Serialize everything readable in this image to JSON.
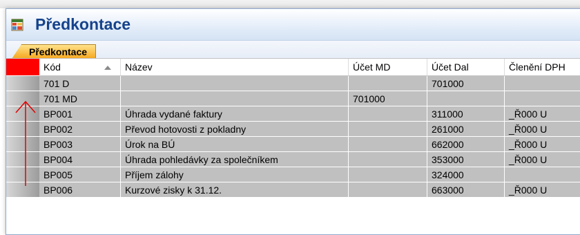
{
  "window": {
    "title": "Předkontace"
  },
  "tab": {
    "label": "Předkontace"
  },
  "grid": {
    "columns": [
      "Kód",
      "Název",
      "Účet MD",
      "Účet Dal",
      "Členění DPH"
    ],
    "sorted_column": "Kód",
    "sort_direction": "ascending",
    "rows": [
      {
        "kod": "701 D",
        "nazev": "",
        "ucet_md": "",
        "ucet_dal": "701000",
        "cleneni_dph": ""
      },
      {
        "kod": "701 MD",
        "nazev": "",
        "ucet_md": "701000",
        "ucet_dal": "",
        "cleneni_dph": ""
      },
      {
        "kod": "BP001",
        "nazev": "Úhrada vydané faktury",
        "ucet_md": "",
        "ucet_dal": "311000",
        "cleneni_dph": "_Ř000 U"
      },
      {
        "kod": "BP002",
        "nazev": "Převod hotovosti z pokladny",
        "ucet_md": "",
        "ucet_dal": "261000",
        "cleneni_dph": "_Ř000 U"
      },
      {
        "kod": "BP003",
        "nazev": "Úrok na BÚ",
        "ucet_md": "",
        "ucet_dal": "662000",
        "cleneni_dph": "_Ř000 U"
      },
      {
        "kod": "BP004",
        "nazev": "Úhrada pohledávky za společníkem",
        "ucet_md": "",
        "ucet_dal": "353000",
        "cleneni_dph": "_Ř000 U"
      },
      {
        "kod": "BP005",
        "nazev": "Příjem zálohy",
        "ucet_md": "",
        "ucet_dal": "324000",
        "cleneni_dph": ""
      },
      {
        "kod": "BP006",
        "nazev": "Kurzové zisky k 31.12.",
        "ucet_md": "",
        "ucet_dal": "663000",
        "cleneni_dph": "_Ř000 U"
      }
    ]
  },
  "colors": {
    "title": "#15428b",
    "select_all_marker": "#ff0000",
    "annotation_arrow": "#e00000",
    "row_fill": "#c0c0c0",
    "tab_fill": "#f5a51c"
  },
  "icons": {
    "app": "table-grid-icon",
    "sort": "sort-ascending-icon",
    "annotation": "up-arrow-annotation"
  }
}
